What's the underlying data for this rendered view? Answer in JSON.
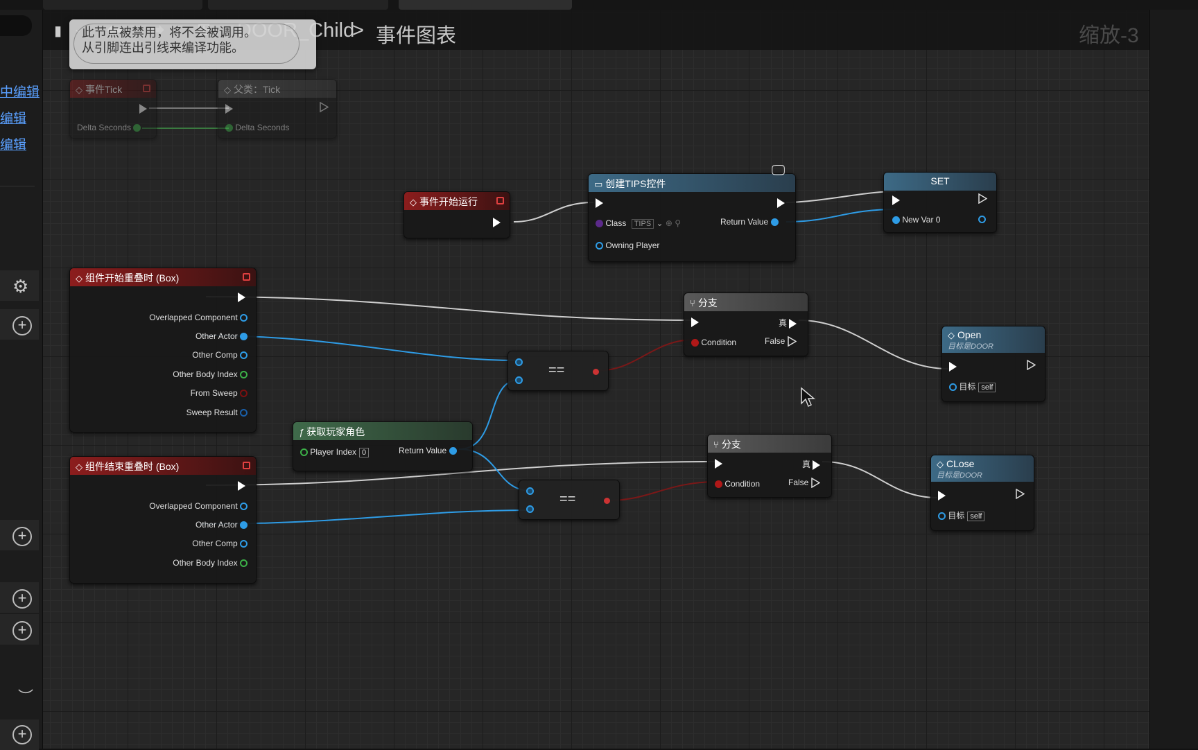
{
  "breadcrumb": {
    "blueprint": "DOOR_Child",
    "sep": ">",
    "graph": "事件图表"
  },
  "zoom_label": "缩放-3",
  "tooltip": {
    "line1": "此节点被禁用，将不会被调用。",
    "line2": "从引脚连出引线来编译功能。"
  },
  "left_panel": {
    "links": [
      "中编辑",
      "编辑",
      "编辑"
    ],
    "icons": [
      "gear-icon",
      "add-icon",
      "add-icon",
      "add-icon",
      "add-icon",
      "eye-closed-icon",
      "add-icon"
    ]
  },
  "nodes": {
    "event_tick": {
      "title": "事件Tick",
      "pin_delta": "Delta Seconds"
    },
    "parent_tick": {
      "title": "父类：Tick",
      "pin_delta": "Delta Seconds"
    },
    "begin_play": {
      "title": "事件开始运行"
    },
    "create_widget": {
      "title": "创建TIPS控件",
      "pin_class": "Class",
      "class_value": "TIPS",
      "pin_return": "Return Value",
      "pin_owning": "Owning Player"
    },
    "set_var": {
      "title": "SET",
      "pin_var": "New Var 0"
    },
    "begin_overlap": {
      "title": "组件开始重叠时 (Box)",
      "pins": [
        "Overlapped Component",
        "Other Actor",
        "Other Comp",
        "Other Body Index",
        "From Sweep",
        "Sweep Result"
      ]
    },
    "end_overlap": {
      "title": "组件结束重叠时 (Box)",
      "pins": [
        "Overlapped Component",
        "Other Actor",
        "Other Comp",
        "Other Body Index"
      ]
    },
    "get_player": {
      "title": "获取玩家角色",
      "pin_index": "Player Index",
      "index_value": "0",
      "pin_return": "Return Value"
    },
    "equal_1": {
      "title": "=="
    },
    "equal_2": {
      "title": "=="
    },
    "branch_1": {
      "title": "分支",
      "pin_true": "真",
      "pin_condition": "Condition",
      "pin_false": "False"
    },
    "branch_2": {
      "title": "分支",
      "pin_true": "真",
      "pin_condition": "Condition",
      "pin_false": "False"
    },
    "open": {
      "title": "Open",
      "subtitle": "目标是DOOR",
      "pin_target": "目标",
      "target_value": "self"
    },
    "close": {
      "title": "CLose",
      "subtitle": "目标是DOOR",
      "pin_target": "目标",
      "target_value": "self"
    }
  },
  "colors": {
    "exec": "#ffffff",
    "object": "#2e9ce6",
    "float": "#3cb048",
    "bool": "#b01818",
    "event_header": "#8c1d1d",
    "function_header": "#3d6a86",
    "pure_header": "#3f6a4a"
  }
}
